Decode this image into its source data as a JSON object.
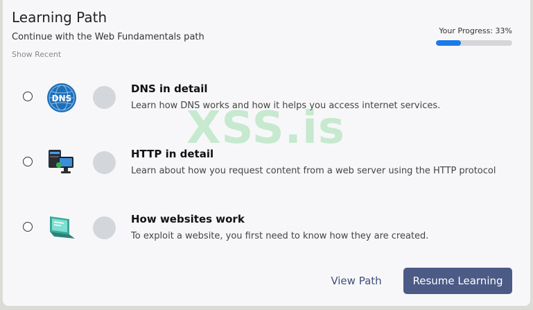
{
  "header": {
    "title": "Learning Path",
    "subtitle": "Continue with the Web Fundamentals path",
    "show_recent": "Show Recent"
  },
  "progress": {
    "label": "Your Progress: 33%",
    "percent": 33,
    "fill_color": "#1c7ae8"
  },
  "modules": [
    {
      "title": "DNS in detail",
      "description": "Learn how DNS works and how it helps you access internet services.",
      "icon": "dns-globe-icon",
      "icon_text": "DNS"
    },
    {
      "title": "HTTP in detail",
      "description": "Learn about how you request content from a web server using the HTTP protocol",
      "icon": "server-computers-icon"
    },
    {
      "title": "How websites work",
      "description": "To exploit a website, you first need to know how they are created.",
      "icon": "laptop-icon"
    }
  ],
  "watermark": "XSS.is",
  "actions": {
    "view_path": "View Path",
    "resume": "Resume Learning"
  },
  "colors": {
    "primary_button": "#4c5a86",
    "link": "#3f4f7c",
    "card_bg": "#f7f7f9"
  }
}
